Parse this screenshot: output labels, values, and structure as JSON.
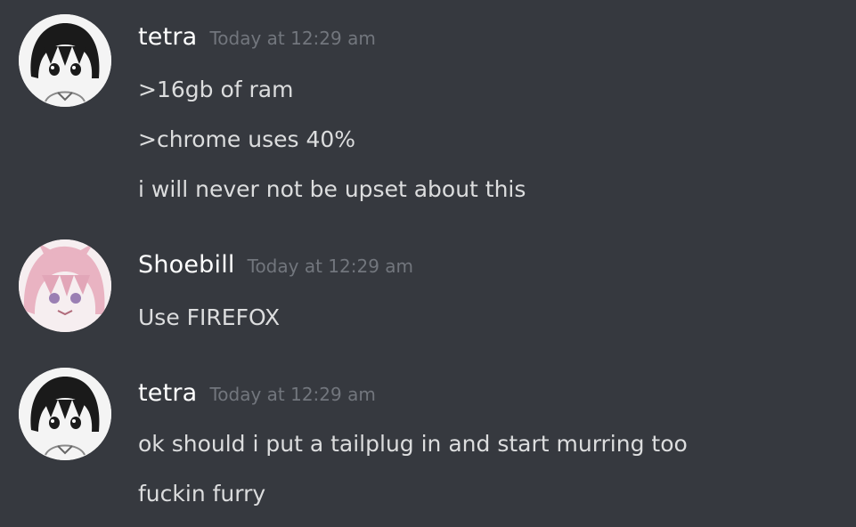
{
  "messages": [
    {
      "author": "tetra",
      "timestamp": "Today at 12:29 am",
      "avatar_icon": "dark-haired-anime-girl-avatar",
      "lines": [
        ">16gb of ram",
        ">chrome uses 40%",
        "i will never not be upset about this"
      ]
    },
    {
      "author": "Shoebill",
      "timestamp": "Today at 12:29 am",
      "avatar_icon": "pink-haired-anime-girl-avatar",
      "lines": [
        "Use FIREFOX"
      ]
    },
    {
      "author": "tetra",
      "timestamp": "Today at 12:29 am",
      "avatar_icon": "dark-haired-anime-girl-avatar",
      "lines": [
        "ok should i put a tailplug in and start murring too",
        "fuckin furry"
      ]
    }
  ],
  "colors": {
    "background": "#36393f",
    "username": "#ffffff",
    "timestamp": "#72767d",
    "message_text": "#dcddde"
  }
}
